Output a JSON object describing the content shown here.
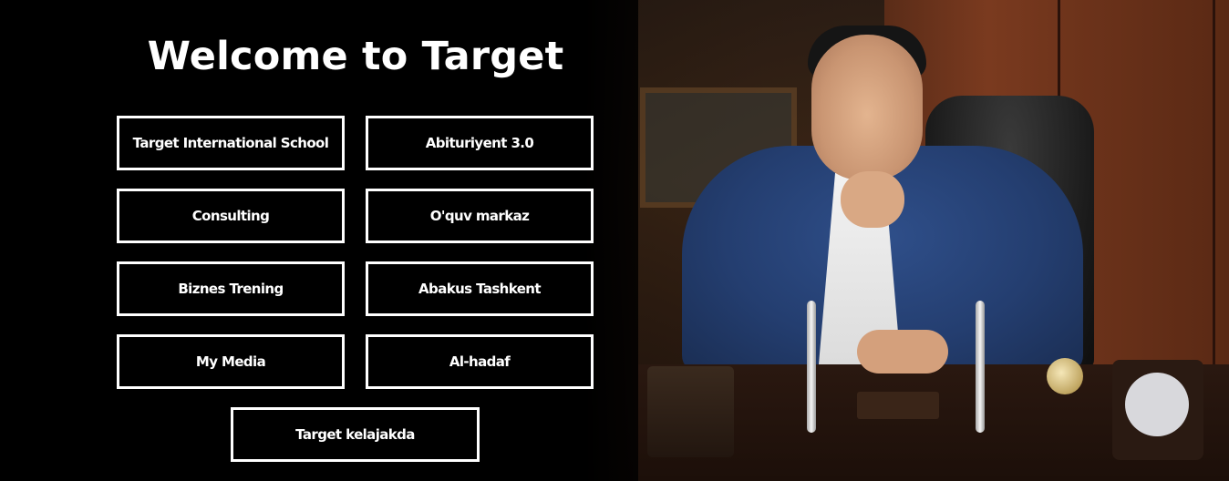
{
  "header": {
    "title": "Welcome to Target"
  },
  "links": [
    {
      "label": "Target International School"
    },
    {
      "label": "Abituriyent 3.0"
    },
    {
      "label": "Consulting"
    },
    {
      "label": "O'quv markaz"
    },
    {
      "label": "Biznes Trening"
    },
    {
      "label": "Abakus Tashkent"
    },
    {
      "label": "My Media"
    },
    {
      "label": "Al-hadaf"
    },
    {
      "label": "Target kelajakda"
    }
  ],
  "colors": {
    "background": "#000000",
    "button_border": "#ffffff",
    "text": "#ffffff"
  }
}
